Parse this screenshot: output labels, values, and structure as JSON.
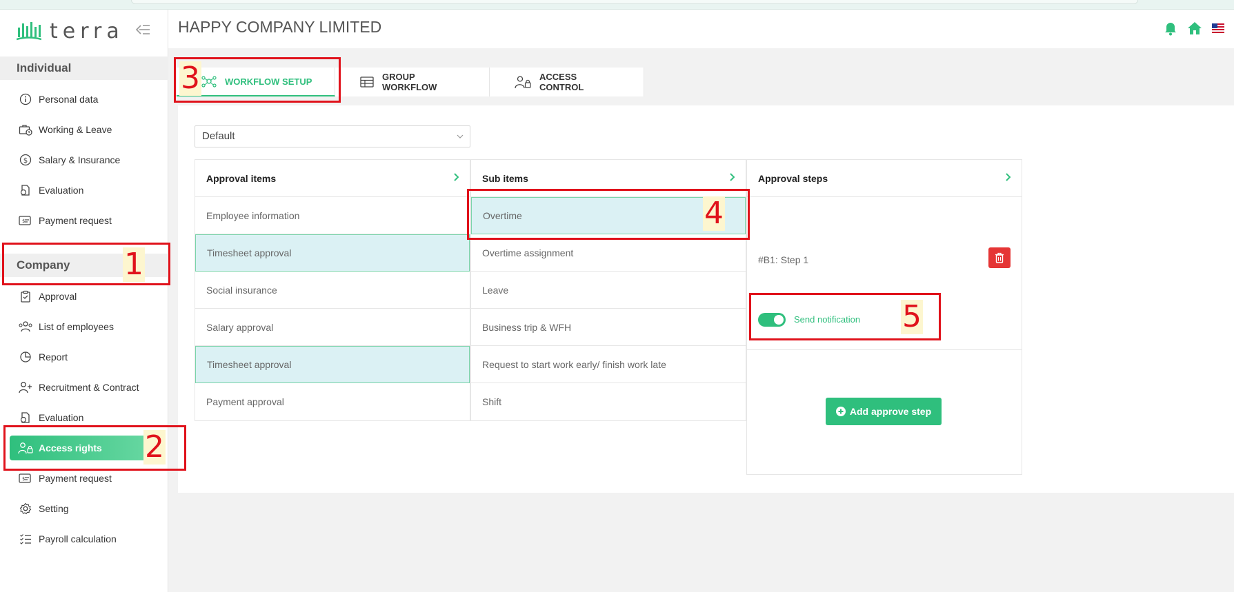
{
  "app": {
    "logo_text": "terra"
  },
  "header": {
    "company_title": "HAPPY COMPANY LIMITED"
  },
  "sidebar": {
    "individual_title": "Individual",
    "individual_items": [
      {
        "label": "Personal data",
        "icon": "info-circle-icon"
      },
      {
        "label": "Working & Leave",
        "icon": "briefcase-clock-icon"
      },
      {
        "label": "Salary & Insurance",
        "icon": "dollar-circle-icon"
      },
      {
        "label": "Evaluation",
        "icon": "document-refresh-icon"
      },
      {
        "label": "Payment request",
        "icon": "payment-card-icon"
      }
    ],
    "company_title": "Company",
    "company_items": [
      {
        "label": "Approval",
        "icon": "clipboard-check-icon"
      },
      {
        "label": "List of employees",
        "icon": "users-icon"
      },
      {
        "label": "Report",
        "icon": "pie-chart-icon"
      },
      {
        "label": "Recruitment & Contract",
        "icon": "user-plus-icon"
      },
      {
        "label": "Evaluation",
        "icon": "document-refresh-icon"
      },
      {
        "label": "Access rights",
        "icon": "user-lock-icon",
        "active": true
      },
      {
        "label": "Payment request",
        "icon": "payment-card-icon"
      },
      {
        "label": "Setting",
        "icon": "gear-icon"
      },
      {
        "label": "Payroll calculation",
        "icon": "checklist-icon"
      }
    ]
  },
  "tabs": [
    {
      "label": "WORKFLOW SETUP",
      "icon": "network-icon",
      "active": true
    },
    {
      "label": "GROUP WORKFLOW",
      "icon": "table-icon"
    },
    {
      "label": "ACCESS CONTROL",
      "icon": "user-lock-icon"
    }
  ],
  "workflow": {
    "selected_template": "Default",
    "approval_items_title": "Approval items",
    "approval_items": [
      {
        "label": "Employee information"
      },
      {
        "label": "Timesheet approval",
        "selected": true
      },
      {
        "label": "Social insurance"
      },
      {
        "label": "Salary approval"
      },
      {
        "label": "Timesheet approval",
        "selected": true
      },
      {
        "label": "Payment approval"
      }
    ],
    "sub_items_title": "Sub items",
    "sub_items": [
      {
        "label": "Overtime",
        "selected": true
      },
      {
        "label": "Overtime assignment"
      },
      {
        "label": "Leave"
      },
      {
        "label": "Business trip & WFH"
      },
      {
        "label": "Request to start work early/ finish work late"
      },
      {
        "label": "Shift"
      }
    ],
    "approval_steps_title": "Approval steps",
    "step_label": "#B1: Step 1",
    "send_notification_label": "Send notification",
    "send_notification_on": true,
    "add_step_label": "Add approve step"
  },
  "annotations": [
    "1",
    "2",
    "3",
    "4",
    "5"
  ],
  "colors": {
    "accent": "#2fbf7d",
    "danger": "#e53535",
    "selected_row": "#dbf1f4",
    "annotation": "#e0121b"
  }
}
